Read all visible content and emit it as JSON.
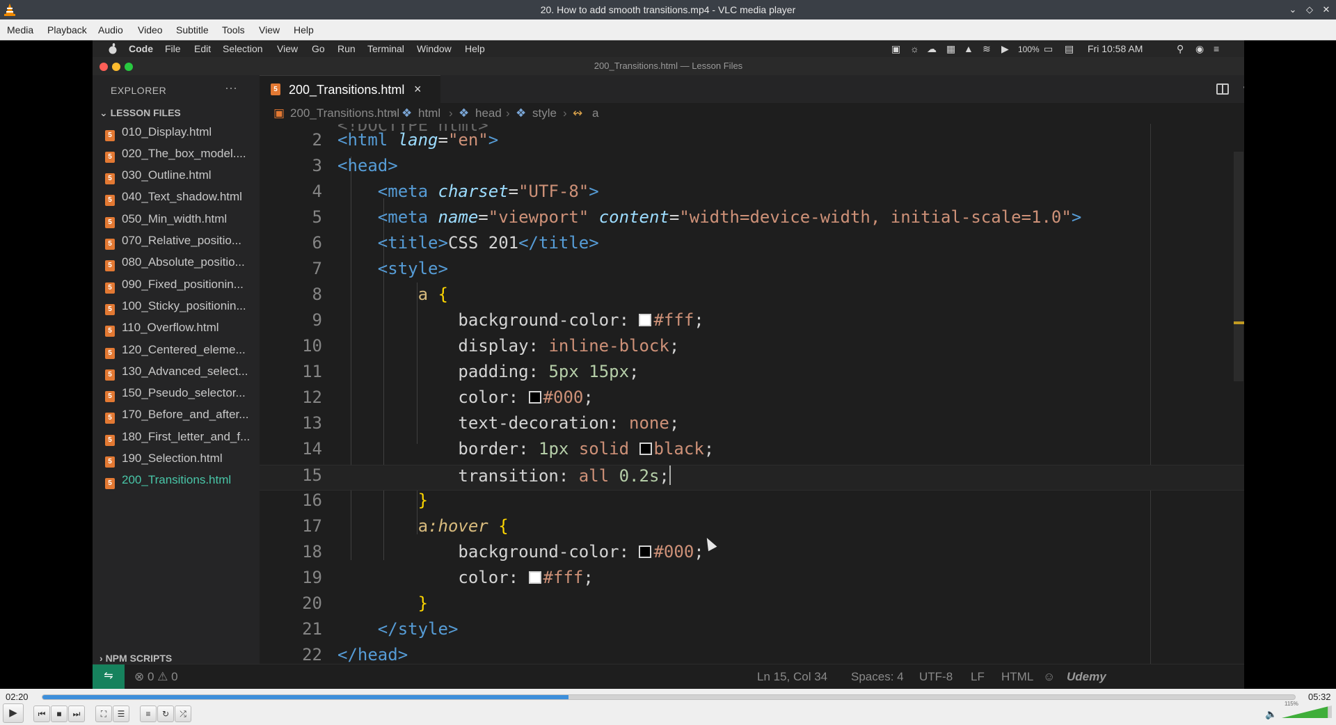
{
  "window": {
    "title": "20. How to add smooth transitions.mp4 - VLC media player",
    "controls": [
      "minimize",
      "restore",
      "close"
    ]
  },
  "menu": [
    "Media",
    "Playback",
    "Audio",
    "Video",
    "Subtitle",
    "Tools",
    "View",
    "Help"
  ],
  "player": {
    "elapsed": "02:20",
    "total": "05:32",
    "progress": 0.42,
    "volume_label": "115%",
    "volume": 1.15
  },
  "screen": {
    "mac_menu": [
      "Code",
      "File",
      "Edit",
      "Selection",
      "View",
      "Go",
      "Run",
      "Terminal",
      "Window",
      "Help"
    ],
    "mac_status": {
      "battery": "100%",
      "clock": "Fri 10:58 AM"
    },
    "window_title": "200_Transitions.html — Lesson Files",
    "explorer": {
      "title": "EXPLORER",
      "more": "···",
      "section": "LESSON FILES",
      "files": [
        "010_Display.html",
        "020_The_box_model....",
        "030_Outline.html",
        "040_Text_shadow.html",
        "050_Min_width.html",
        "070_Relative_positio...",
        "080_Absolute_positio...",
        "090_Fixed_positionin...",
        "100_Sticky_positionin...",
        "110_Overflow.html",
        "120_Centered_eleme...",
        "130_Advanced_select...",
        "150_Pseudo_selector...",
        "170_Before_and_after...",
        "180_First_letter_and_f...",
        "190_Selection.html",
        "200_Transitions.html"
      ],
      "active_index": 16,
      "npm_section": "NPM SCRIPTS"
    },
    "tab": {
      "name": "200_Transitions.html",
      "close": "×"
    },
    "editor_more": "···",
    "breadcrumb": [
      "200_Transitions.html",
      "html",
      "head",
      "style",
      "a"
    ],
    "line_numbers": [
      "2",
      "3",
      "4",
      "5",
      "6",
      "7",
      "8",
      "9",
      "10",
      "11",
      "12",
      "13",
      "14",
      "15",
      "16",
      "17",
      "18",
      "19",
      "20",
      "21",
      "22"
    ],
    "current_line": 15,
    "status": {
      "problems": "⊗ 0 ⚠ 0",
      "position": "Ln 15, Col 34",
      "spaces": "Spaces: 4",
      "encoding": "UTF-8",
      "eol": "LF",
      "language": "HTML",
      "watermark": "Udemy"
    }
  },
  "colors": {
    "accent": "#3d8fdb",
    "html_icon": "#e37933",
    "active_file": "#49c6a8",
    "remote": "#16825d"
  }
}
